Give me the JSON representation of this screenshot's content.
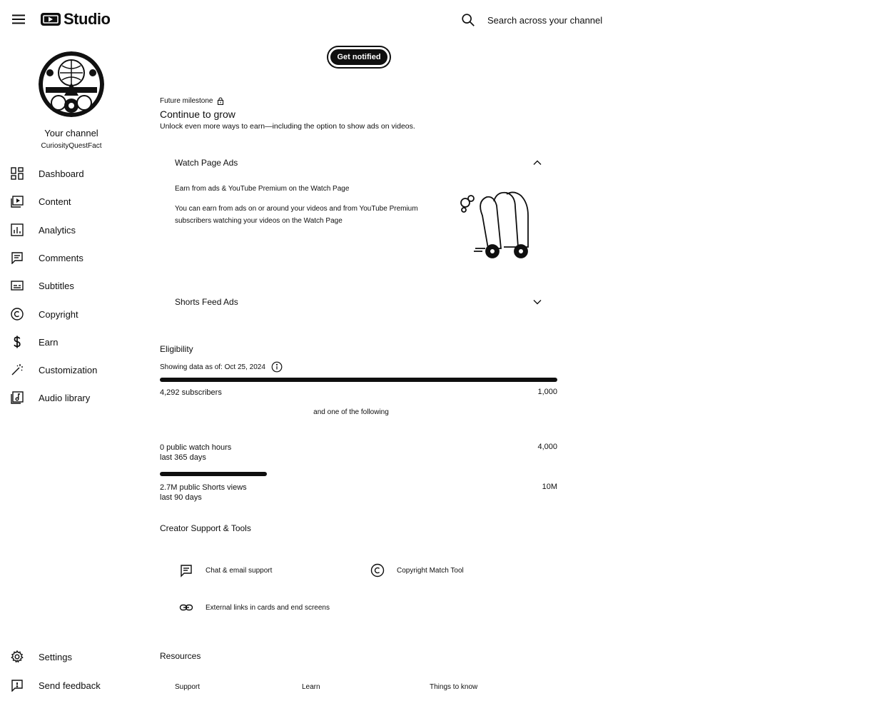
{
  "header": {
    "logo_text": "Studio",
    "search_placeholder": "Search across your channel"
  },
  "sidebar": {
    "channel_title": "Your channel",
    "channel_handle": "CuriosityQuestFact",
    "items": [
      {
        "label": "Dashboard",
        "icon": "dashboard-icon"
      },
      {
        "label": "Content",
        "icon": "content-icon"
      },
      {
        "label": "Analytics",
        "icon": "analytics-icon"
      },
      {
        "label": "Comments",
        "icon": "comments-icon"
      },
      {
        "label": "Subtitles",
        "icon": "subtitles-icon"
      },
      {
        "label": "Copyright",
        "icon": "copyright-icon"
      },
      {
        "label": "Earn",
        "icon": "dollar-icon"
      },
      {
        "label": "Customization",
        "icon": "magic-wand-icon"
      },
      {
        "label": "Audio library",
        "icon": "audio-library-icon"
      }
    ],
    "bottom_items": [
      {
        "label": "Settings",
        "icon": "gear-icon"
      },
      {
        "label": "Send feedback",
        "icon": "feedback-icon"
      }
    ]
  },
  "main": {
    "notify_label": "Get notified",
    "milestone_label": "Future milestone",
    "milestone_title": "Continue to grow",
    "milestone_desc": "Unlock even more ways to earn—including the option to show ads on videos.",
    "watch_ads": {
      "title": "Watch Page Ads",
      "subtitle": "Earn from ads & YouTube Premium on the Watch Page",
      "text": "You can earn from ads on or around your videos and from YouTube Premium subscribers watching your videos on the Watch Page"
    },
    "shorts_ads": {
      "title": "Shorts Feed Ads"
    },
    "eligibility": {
      "title": "Eligibility",
      "as_of": "Showing data as of: Oct 25, 2024",
      "subscribers": {
        "label": "4,292 subscribers",
        "target": "1,000",
        "progress": 1.0
      },
      "and_one": "and one of the following",
      "watch_hours": {
        "label": "0 public watch hours",
        "sublabel": "last 365 days",
        "target": "4,000",
        "progress": 0.0
      },
      "shorts_views": {
        "label": "2.7M public Shorts views",
        "sublabel": "last 90 days",
        "target": "10M",
        "progress": 0.27
      }
    },
    "support": {
      "title": "Creator Support & Tools",
      "tools": [
        {
          "label": "Chat & email support",
          "icon": "chat-icon"
        },
        {
          "label": "Copyright Match Tool",
          "icon": "copyright-icon"
        },
        {
          "label": "External links in cards and end screens",
          "icon": "link-icon"
        }
      ]
    },
    "resources": {
      "title": "Resources",
      "links": [
        "Support",
        "Learn",
        "Things to know"
      ]
    }
  }
}
